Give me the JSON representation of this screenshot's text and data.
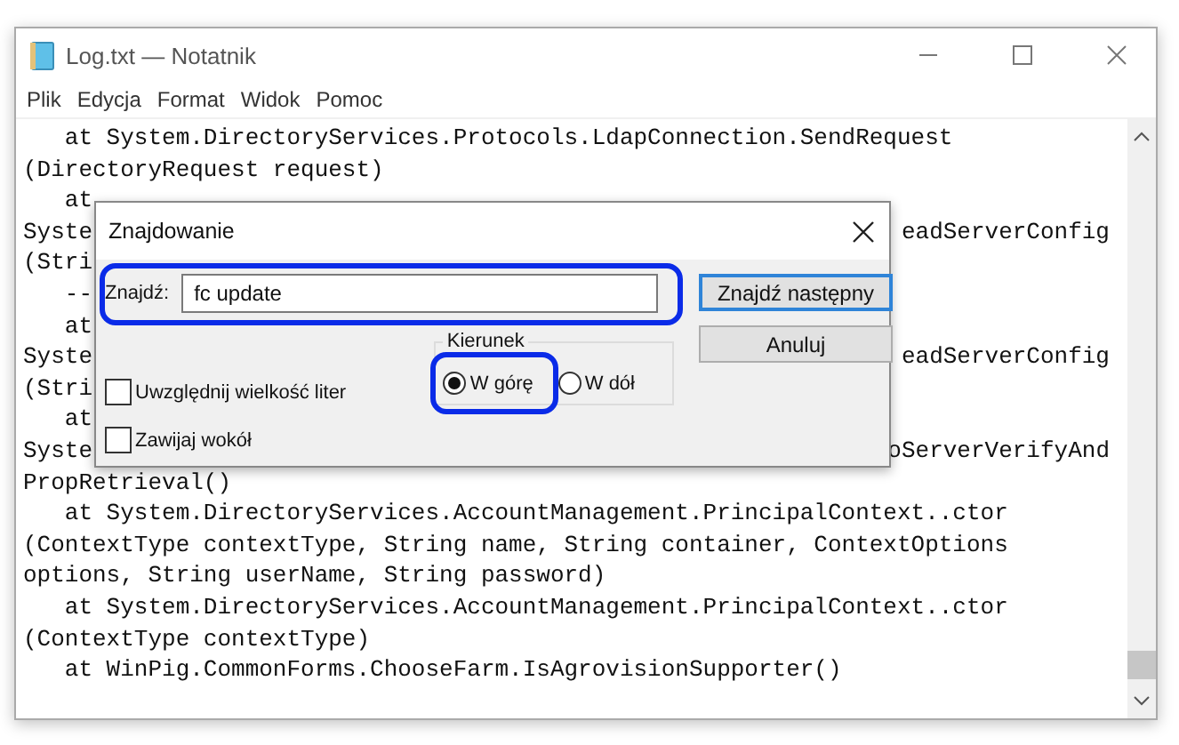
{
  "window": {
    "title": "Log.txt — Notatnik"
  },
  "menu": [
    "Plik",
    "Edycja",
    "Format",
    "Widok",
    "Pomoc"
  ],
  "text_lines": [
    {
      "left": "   at System.DirectoryServices.Protocols.LdapConnection.SendRequest"
    },
    {
      "left": "(DirectoryRequest request)"
    },
    {
      "left": "   at"
    },
    {
      "left": "Syste",
      "right": "eadServerConfig"
    },
    {
      "left": "(Stri"
    },
    {
      "left": "   --"
    },
    {
      "left": "   at"
    },
    {
      "left": "Syste",
      "right": "eadServerConfig"
    },
    {
      "left": "(Stri"
    },
    {
      "left": "   at"
    },
    {
      "left": "Syste",
      "right": "oServerVerifyAnd"
    },
    {
      "left": "PropRetrieval()"
    },
    {
      "left": "   at System.DirectoryServices.AccountManagement.PrincipalContext..ctor"
    },
    {
      "left": "(ContextType contextType, String name, String container, ContextOptions"
    },
    {
      "left": "options, String userName, String password)"
    },
    {
      "left": "   at System.DirectoryServices.AccountManagement.PrincipalContext..ctor"
    },
    {
      "left": "(ContextType contextType)"
    },
    {
      "left": "   at WinPig.CommonForms.ChooseFarm.IsAgrovisionSupporter()"
    }
  ],
  "find_dialog": {
    "title": "Znajdowanie",
    "find_label": "Znajdź:",
    "find_value": "fc update",
    "buttons": [
      {
        "label": "Znajdź następny",
        "default": true
      },
      {
        "label": "Anuluj",
        "default": false
      }
    ],
    "options": [
      {
        "label": "Uwzględnij wielkość liter",
        "checked": false
      },
      {
        "label": "Zawijaj wokół",
        "checked": false
      }
    ],
    "direction": {
      "label": "Kierunek",
      "options": [
        {
          "label": "W górę",
          "selected": true
        },
        {
          "label": "W dół",
          "selected": false
        }
      ]
    }
  }
}
